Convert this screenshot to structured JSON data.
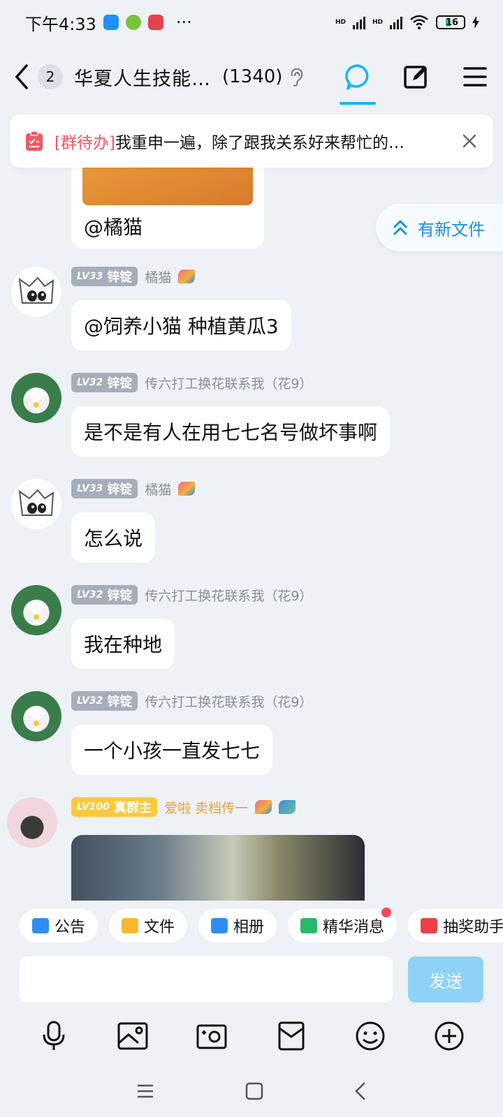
{
  "status_bar": {
    "time": "下午4:33",
    "more": "···",
    "signal1": "HD",
    "signal2": "HD",
    "battery": "16"
  },
  "header": {
    "unread_count": "2",
    "group_name": "华夏人生技能…",
    "member_count": "(1340)"
  },
  "todo": {
    "tag": "[群待办]",
    "text": "我重申一遍，除了跟我关系好来帮忙的…"
  },
  "new_file_label": "有新文件",
  "messages": [
    {
      "text": "@橘猫"
    },
    {
      "level": "LV33",
      "title": "锌锭",
      "name": "橘猫",
      "text": "@饲养小猫 种植黄瓜3"
    },
    {
      "level": "LV32",
      "title": "锌锭",
      "name": "传六打工换花联系我（花9）",
      "text": "是不是有人在用七七名号做坏事啊"
    },
    {
      "level": "LV33",
      "title": "锌锭",
      "name": "橘猫",
      "text": "怎么说"
    },
    {
      "level": "LV32",
      "title": "锌锭",
      "name": "传六打工换花联系我（花9）",
      "text": "我在种地"
    },
    {
      "level": "LV32",
      "title": "锌锭",
      "name": "传六打工换花联系我（花9）",
      "text": "一个小孩一直发七七"
    },
    {
      "level": "LV100",
      "title": "真群主",
      "name": "爱啦 卖档传一"
    }
  ],
  "quick_bar": [
    "公告",
    "文件",
    "相册",
    "精华消息",
    "抽奖助手"
  ],
  "send_label": "发送",
  "colors": {
    "accent": "#12b7f5",
    "send": "#8fd2f8",
    "todo_tag": "#f25767"
  }
}
